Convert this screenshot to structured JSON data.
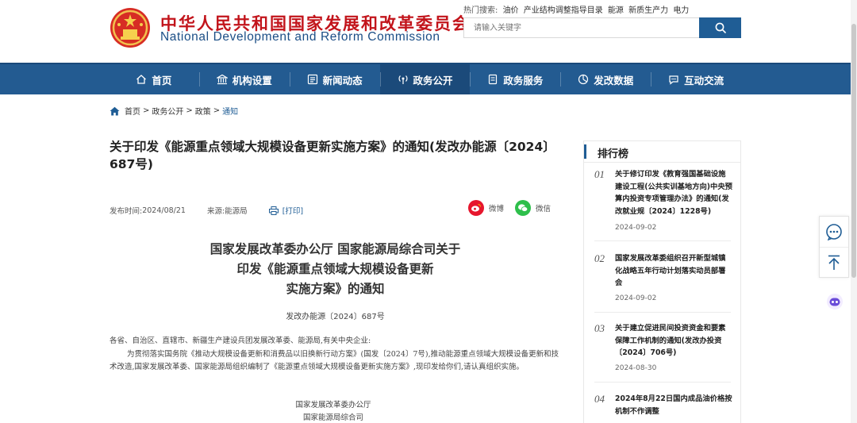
{
  "header": {
    "site_name_cn": "中华人民共和国国家发展和改革委员会",
    "site_name_en": "National Development and Reform Commission",
    "hot_label": "热门搜索:",
    "hot_keywords": [
      "油价",
      "产业结构调整指导目录",
      "能源",
      "新质生产力",
      "电力"
    ],
    "search_placeholder": "请输入关键字"
  },
  "nav": {
    "items": [
      {
        "label": "首页",
        "icon": "home-icon"
      },
      {
        "label": "机构设置",
        "icon": "building-icon"
      },
      {
        "label": "新闻动态",
        "icon": "news-icon"
      },
      {
        "label": "政务公开",
        "icon": "broadcast-icon"
      },
      {
        "label": "政务服务",
        "icon": "document-icon"
      },
      {
        "label": "发改数据",
        "icon": "pie-chart-icon"
      },
      {
        "label": "互动交流",
        "icon": "chat-icon"
      }
    ],
    "active_index": 3
  },
  "breadcrumb": {
    "items": [
      "首页",
      "政务公开",
      "政策",
      "通知"
    ],
    "separator": ">"
  },
  "article": {
    "title": "关于印发《能源重点领域大规模设备更新实施方案》的通知(发改办能源〔2024〕687号)",
    "publish_label": "发布时间:",
    "publish_date": "2024/08/21",
    "source_label": "来源:",
    "source": "能源局",
    "print_label": "[打印]",
    "share_weibo": "微博",
    "share_wechat": "微信",
    "doc_title_lines": [
      "国家发展改革委办公厅 国家能源局综合司关于",
      "印发《能源重点领域大规模设备更新",
      "实施方案》的通知"
    ],
    "doc_number": "发改办能源〔2024〕687号",
    "recipients": "各省、自治区、直辖市、新疆生产建设兵团发展改革委、能源局,有关中央企业:",
    "body": "为贯彻落实国务院《推动大规模设备更新和消费品以旧换新行动方案》(国发〔2024〕7号),推动能源重点领域大规模设备更新和技术改造,国家发展改革委、国家能源局组织编制了《能源重点领域大规模设备更新实施方案》,现印发给你们,请认真组织实施。",
    "signatures": [
      "国家发展改革委办公厅",
      "国家能源局综合司"
    ]
  },
  "ranking": {
    "title": "排行榜",
    "items": [
      {
        "num": "01",
        "title": "关于修订印发《教育强国基础设施建设工程(公共实训基地方向)中央预算内投资专项管理办法》的通知(发改就业规〔2024〕1228号)",
        "date": "2024-09-02"
      },
      {
        "num": "02",
        "title": "国家发展改革委组织召开新型城镇化战略五年行动计划落实动员部署会",
        "date": "2024-09-02"
      },
      {
        "num": "03",
        "title": "关于建立促进民间投资资金和要素保障工作机制的通知(发改办投资〔2024〕706号)",
        "date": "2024-08-30"
      },
      {
        "num": "04",
        "title": "2024年8月22日国内成品油价格按机制不作调整",
        "date": ""
      }
    ]
  },
  "colors": {
    "brand_red": "#c2141b",
    "brand_blue": "#1f5d95",
    "nav_bg": "#235b91"
  }
}
